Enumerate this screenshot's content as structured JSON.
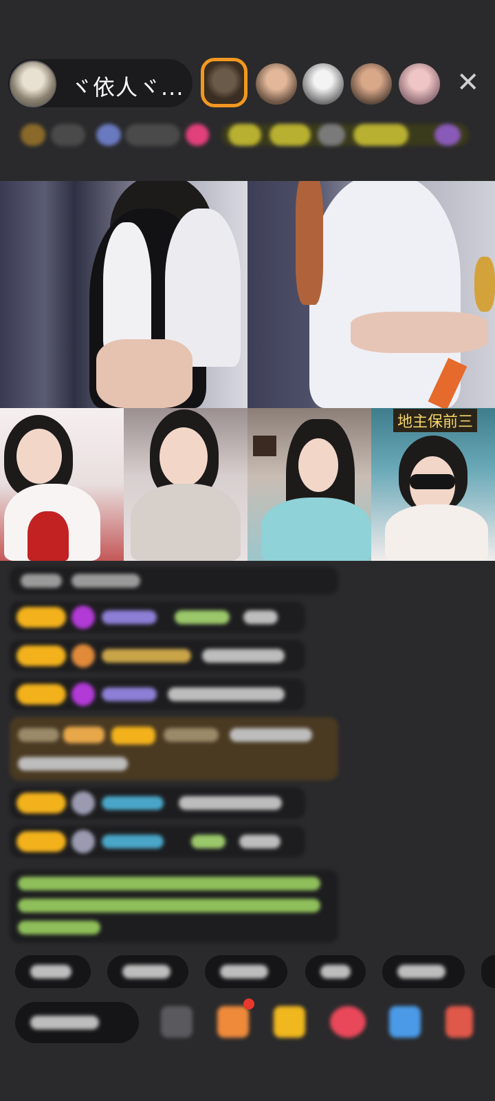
{
  "header": {
    "host_name": "ヾ依人ヾ...",
    "close_icon": "close-icon"
  },
  "grid": {
    "tile_6_label": "地主保前三"
  },
  "colors": {
    "accent": "#f3b21c",
    "background": "#2a2a2c",
    "notification": "#e8382e",
    "highlight_message": "#4a3a22"
  }
}
